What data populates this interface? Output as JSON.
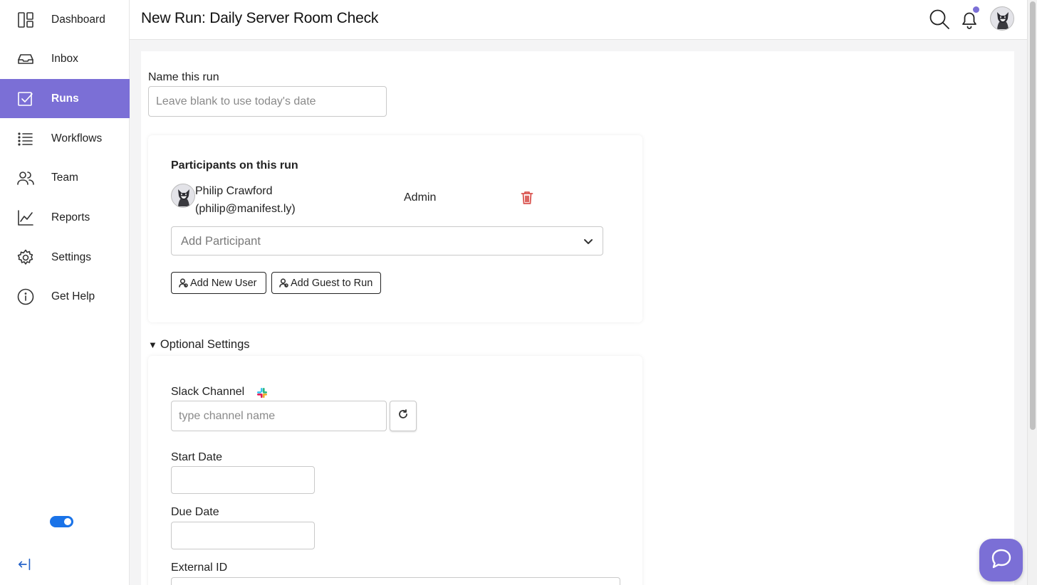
{
  "sidebar": {
    "items": [
      {
        "label": "Dashboard",
        "icon": "dashboard-icon"
      },
      {
        "label": "Inbox",
        "icon": "inbox-icon"
      },
      {
        "label": "Runs",
        "icon": "runs-checkbox-icon",
        "active": true
      },
      {
        "label": "Workflows",
        "icon": "list-icon"
      },
      {
        "label": "Team",
        "icon": "team-icon"
      },
      {
        "label": "Reports",
        "icon": "chart-icon"
      },
      {
        "label": "Settings",
        "icon": "gear-icon"
      },
      {
        "label": "Get Help",
        "icon": "info-icon"
      }
    ],
    "toggle_on": true
  },
  "header": {
    "title": "New Run: Daily Server Room Check",
    "notification_dot_color": "#7b6fd6"
  },
  "form": {
    "name_label": "Name this run",
    "name_placeholder": "Leave blank to use today's date",
    "name_value": "",
    "participants": {
      "title": "Participants on this run",
      "list": [
        {
          "name": "Philip Crawford",
          "email": "(philip@manifest.ly)",
          "role": "Admin"
        }
      ],
      "add_placeholder": "Add Participant",
      "add_new_user_label": "Add New User",
      "add_guest_label": "Add Guest to Run"
    },
    "optional_settings": {
      "toggle_label": "Optional Settings",
      "expanded": true,
      "slack_label": "Slack Channel",
      "slack_placeholder": "type channel name",
      "start_date_label": "Start Date",
      "due_date_label": "Due Date",
      "external_id_label": "External ID"
    }
  },
  "colors": {
    "accent": "#7b6fd6",
    "toggle": "#1a73e8",
    "danger": "#d9534f"
  }
}
